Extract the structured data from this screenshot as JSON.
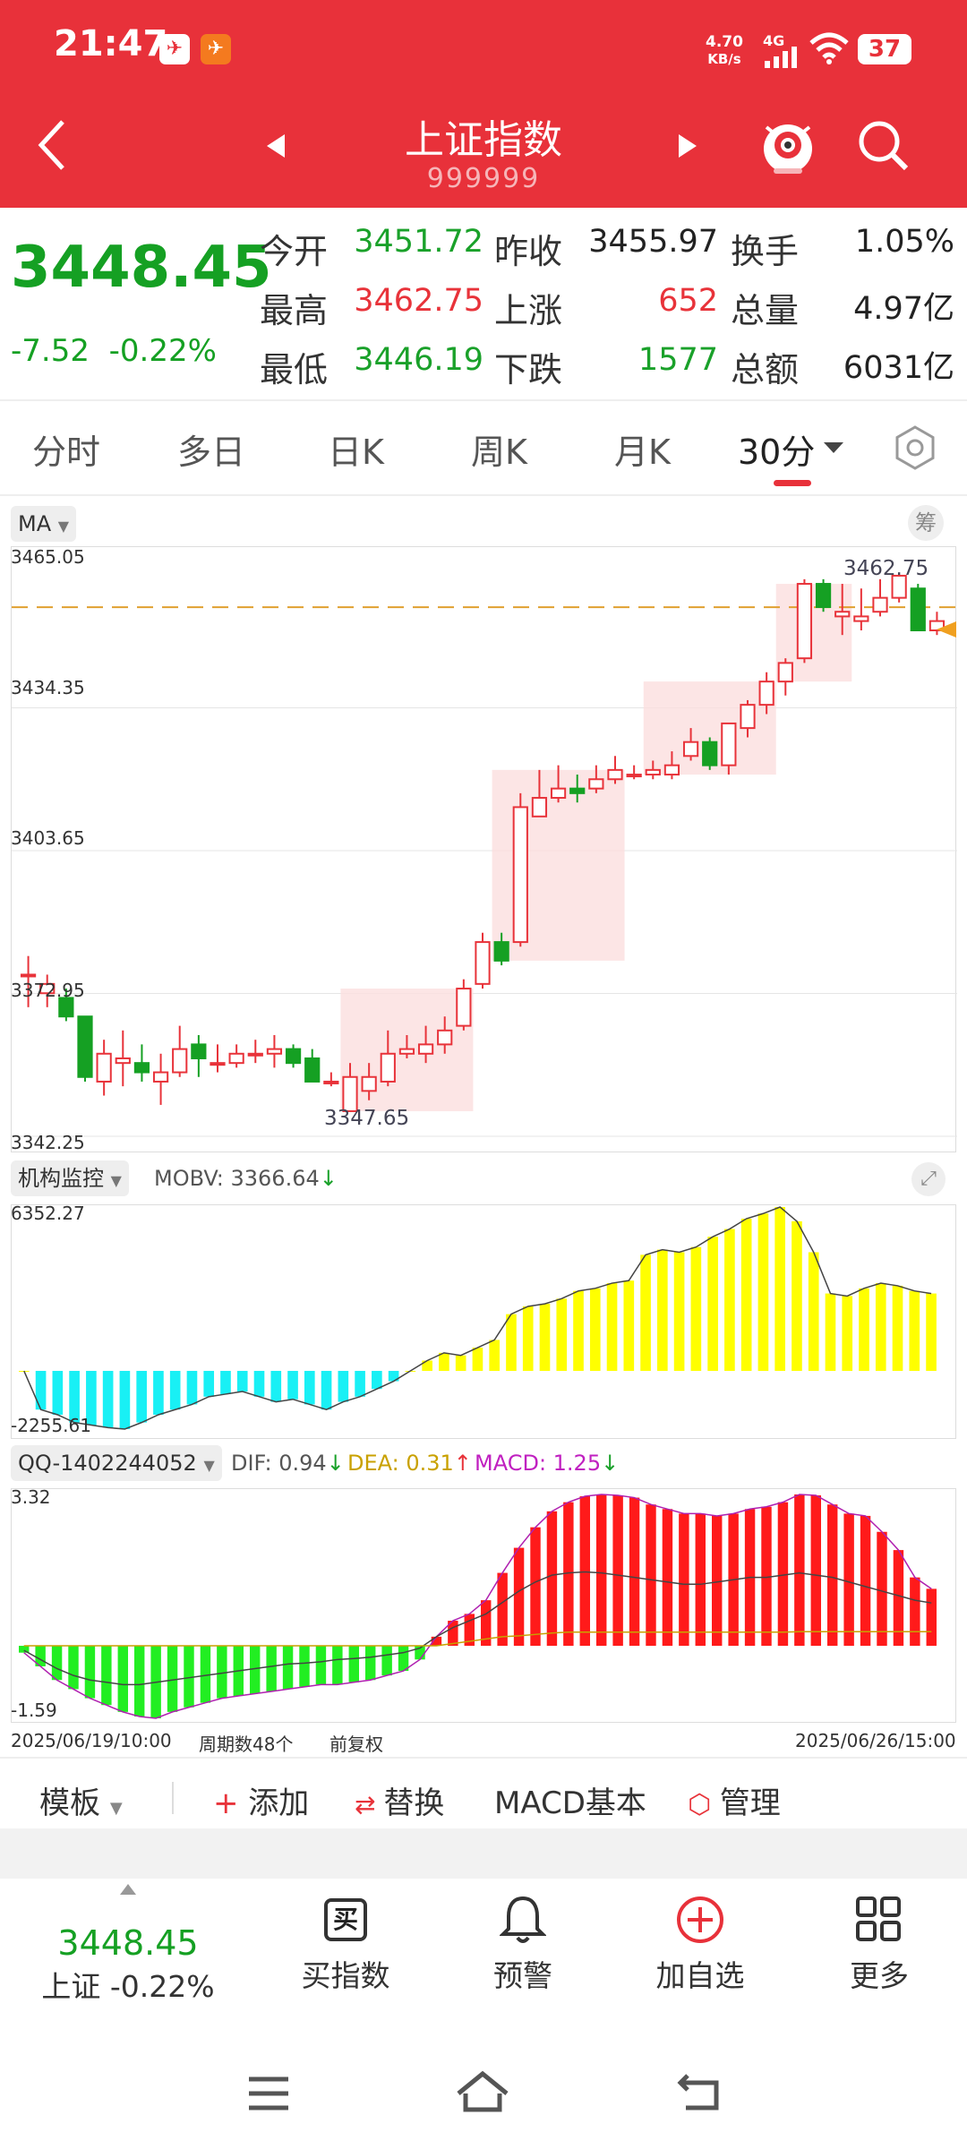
{
  "status": {
    "time": "21:47",
    "net_speed_value": "4.70",
    "net_speed_unit": "KB/s",
    "network": "4G",
    "battery": "37"
  },
  "header": {
    "title": "上证指数",
    "code": "999999"
  },
  "quote": {
    "price": "3448.45",
    "change": "-7.52",
    "change_pct": "-0.22%",
    "rows": [
      {
        "l1": "今开",
        "v1": "3451.72",
        "l2": "昨收",
        "v2": "3455.97",
        "l3": "换手",
        "v3": "1.05%"
      },
      {
        "l1": "最高",
        "v1": "3462.75",
        "l2": "上涨",
        "v2": "652",
        "l3": "总量",
        "v3": "4.97亿"
      },
      {
        "l1": "最低",
        "v1": "3446.19",
        "l2": "下跌",
        "v2": "1577",
        "l3": "总额",
        "v3": "6031亿"
      }
    ]
  },
  "tabs": [
    "分时",
    "多日",
    "日K",
    "周K",
    "月K",
    "30分"
  ],
  "chart": {
    "ma_label": "MA",
    "chip_label": "筹",
    "y_labels": [
      "3465.05",
      "3434.35",
      "3403.65",
      "3372.95",
      "3342.25"
    ],
    "high_label": "3462.75",
    "low_label": "3347.65",
    "obv_label": "机构监控",
    "obv_value": "MOBV: 3366.64",
    "obv_top": "6352.27",
    "obv_bottom": "-2255.61",
    "macd_label": "QQ-1402244052",
    "dif": "DIF: 0.94",
    "dea": "DEA: 0.31",
    "macd": "MACD: 1.25",
    "macd_top": "3.32",
    "macd_bottom": "-1.59",
    "date_start": "2025/06/19/10:00",
    "period_count": "周期数48个",
    "adjust": "前复权",
    "date_end": "2025/06/26/15:00"
  },
  "chart_data": {
    "type": "candlestick",
    "ylim": [
      3342.25,
      3465.05
    ],
    "candles": [
      [
        3377,
        3377,
        3370,
        3381
      ],
      [
        3373,
        3375,
        3370,
        3377
      ],
      [
        3372,
        3368,
        3367,
        3374
      ],
      [
        3368,
        3355,
        3354,
        3368
      ],
      [
        3354,
        3360,
        3351,
        3363
      ],
      [
        3358,
        3359,
        3353,
        3365
      ],
      [
        3358,
        3356,
        3354,
        3362
      ],
      [
        3354,
        3356,
        3349,
        3360
      ],
      [
        3356,
        3361,
        3355,
        3366
      ],
      [
        3362,
        3359,
        3355,
        3364
      ],
      [
        3358,
        3358,
        3356,
        3362
      ],
      [
        3358,
        3360,
        3357,
        3362
      ],
      [
        3360,
        3360,
        3358,
        3363
      ],
      [
        3360,
        3361,
        3357,
        3364
      ],
      [
        3361,
        3358,
        3357,
        3362
      ],
      [
        3359,
        3354,
        3354,
        3361
      ],
      [
        3354,
        3354,
        3353,
        3356
      ],
      [
        3347.65,
        3355,
        3347.65,
        3358
      ],
      [
        3352,
        3355,
        3350,
        3358
      ],
      [
        3354,
        3360,
        3353,
        3365
      ],
      [
        3360,
        3361,
        3359,
        3364
      ],
      [
        3360,
        3362,
        3358,
        3366
      ],
      [
        3362,
        3365,
        3360,
        3368
      ],
      [
        3366,
        3374,
        3365,
        3376
      ],
      [
        3375,
        3384,
        3374,
        3386
      ],
      [
        3384,
        3380,
        3379,
        3386
      ],
      [
        3384,
        3413,
        3383,
        3416
      ],
      [
        3411,
        3415,
        3412,
        3421
      ],
      [
        3415,
        3417,
        3414,
        3422
      ],
      [
        3417,
        3416,
        3414,
        3420
      ],
      [
        3417,
        3419,
        3416,
        3422
      ],
      [
        3419,
        3421,
        3418,
        3424
      ],
      [
        3420,
        3420,
        3419,
        3422
      ],
      [
        3420,
        3421,
        3419,
        3423
      ],
      [
        3420,
        3422,
        3419,
        3425
      ],
      [
        3424,
        3427,
        3423,
        3430
      ],
      [
        3427,
        3422,
        3421,
        3428
      ],
      [
        3422,
        3431,
        3420,
        3431
      ],
      [
        3430,
        3435,
        3428,
        3436
      ],
      [
        3435,
        3440,
        3433,
        3442
      ],
      [
        3440,
        3444,
        3437,
        3445
      ],
      [
        3445,
        3461,
        3444,
        3462
      ],
      [
        3461,
        3456,
        3455,
        3462
      ],
      [
        3454,
        3455,
        3450,
        3461
      ],
      [
        3453,
        3454,
        3451,
        3460
      ],
      [
        3455,
        3458,
        3454,
        3462
      ],
      [
        3458,
        3462.75,
        3457,
        3462.75
      ],
      [
        3460,
        3451,
        3451,
        3461
      ],
      [
        3451,
        3453,
        3450,
        3455
      ]
    ],
    "obv": [
      0,
      -1500,
      -1700,
      -2000,
      -2100,
      -2200,
      -2255,
      -2000,
      -1700,
      -1500,
      -1300,
      -1000,
      -900,
      -800,
      -1000,
      -1200,
      -1100,
      -1300,
      -1500,
      -1200,
      -1000,
      -700,
      -400,
      0,
      400,
      700,
      600,
      900,
      1200,
      2200,
      2500,
      2600,
      2800,
      3100,
      3200,
      3400,
      3500,
      4500,
      4700,
      4600,
      4800,
      5200,
      5500,
      5900,
      6100,
      6352,
      5800,
      4600,
      3000,
      2900,
      3200,
      3400,
      3300,
      3100,
      3000
    ],
    "macd_hist": [
      -0.15,
      -0.45,
      -0.75,
      -0.95,
      -1.15,
      -1.3,
      -1.45,
      -1.55,
      -1.59,
      -1.45,
      -1.35,
      -1.25,
      -1.15,
      -1.1,
      -1.05,
      -1.0,
      -0.95,
      -0.9,
      -0.85,
      -0.85,
      -0.8,
      -0.75,
      -0.65,
      -0.55,
      -0.3,
      0.2,
      0.55,
      0.7,
      1.0,
      1.6,
      2.15,
      2.6,
      2.95,
      3.15,
      3.28,
      3.32,
      3.3,
      3.25,
      3.1,
      3.0,
      2.9,
      2.9,
      2.85,
      2.9,
      3.0,
      3.05,
      3.15,
      3.32,
      3.3,
      3.1,
      2.9,
      2.85,
      2.5,
      2.1,
      1.5,
      1.25
    ],
    "dif": [
      -0.1,
      -0.3,
      -0.5,
      -0.65,
      -0.75,
      -0.8,
      -0.85,
      -0.85,
      -0.8,
      -0.75,
      -0.7,
      -0.65,
      -0.6,
      -0.55,
      -0.5,
      -0.45,
      -0.4,
      -0.38,
      -0.35,
      -0.3,
      -0.28,
      -0.25,
      -0.2,
      -0.15,
      -0.05,
      0.2,
      0.4,
      0.55,
      0.7,
      0.95,
      1.2,
      1.4,
      1.55,
      1.6,
      1.62,
      1.6,
      1.55,
      1.5,
      1.45,
      1.4,
      1.35,
      1.35,
      1.4,
      1.45,
      1.5,
      1.5,
      1.55,
      1.6,
      1.55,
      1.5,
      1.4,
      1.3,
      1.2,
      1.1,
      1.0,
      0.94
    ],
    "dea": [
      0,
      0,
      0,
      0,
      0,
      0,
      0,
      0,
      0,
      0,
      0,
      0,
      0,
      0,
      0,
      0,
      0,
      0,
      0,
      0,
      0,
      0,
      0,
      0,
      0,
      0,
      0.05,
      0.1,
      0.15,
      0.2,
      0.22,
      0.25,
      0.28,
      0.3,
      0.3,
      0.3,
      0.3,
      0.3,
      0.3,
      0.3,
      0.3,
      0.3,
      0.3,
      0.3,
      0.3,
      0.3,
      0.3,
      0.31,
      0.31,
      0.31,
      0.31,
      0.31,
      0.31,
      0.31,
      0.31,
      0.31
    ]
  },
  "toolbar": {
    "template": "模板",
    "add": "添加",
    "replace": "替换",
    "macd_basic": "MACD基本",
    "manage": "管理"
  },
  "bottom": {
    "price": "3448.45",
    "label": "上证 -0.22%",
    "buy": "买指数",
    "buy_icon": "买",
    "alert": "预警",
    "watch": "加自选",
    "more": "更多"
  },
  "colors": {
    "header": "#e8313a",
    "up": "#e8333a",
    "down": "#15a023",
    "obv_pos": "#ffff00",
    "obv_neg": "#19f0f5"
  }
}
